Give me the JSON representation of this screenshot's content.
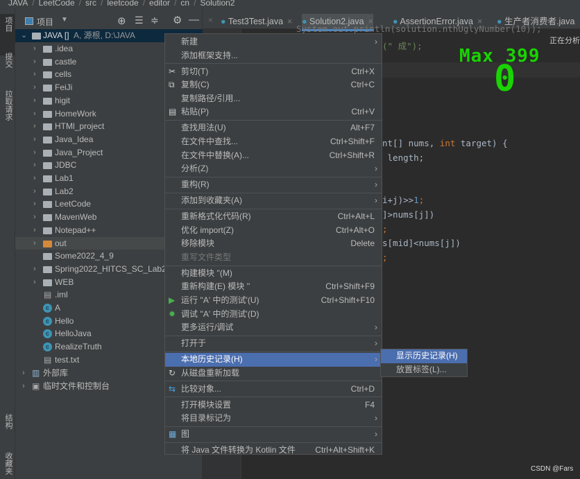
{
  "breadcrumb": [
    "JAVA",
    "LeetCode",
    "src",
    "leetcode",
    "editor",
    "cn",
    "Solution2"
  ],
  "left_strip": {
    "top": [
      "项目",
      "提交",
      "拉取请求"
    ],
    "bottom": [
      "结构",
      "收藏夹"
    ]
  },
  "project_panel": {
    "title": "项目",
    "root": {
      "name": "JAVA []",
      "detail": "A, 源根, D:\\JAVA"
    },
    "items": [
      {
        "name": ".idea",
        "type": "folder",
        "expandable": true
      },
      {
        "name": "castle",
        "type": "folder",
        "expandable": true
      },
      {
        "name": "cells",
        "type": "folder",
        "expandable": true
      },
      {
        "name": "FeiJi",
        "type": "folder",
        "expandable": true
      },
      {
        "name": "higit",
        "type": "folder",
        "expandable": true
      },
      {
        "name": "HomeWork",
        "type": "folder",
        "expandable": true
      },
      {
        "name": "HTMl_project",
        "type": "folder",
        "expandable": true
      },
      {
        "name": "Java_Idea",
        "type": "folder",
        "expandable": true
      },
      {
        "name": "Java_Project",
        "type": "folder",
        "expandable": true
      },
      {
        "name": "JDBC",
        "type": "folder",
        "expandable": true
      },
      {
        "name": "Lab1",
        "type": "folder",
        "expandable": true
      },
      {
        "name": "Lab2",
        "type": "folder",
        "expandable": true
      },
      {
        "name": "LeetCode",
        "type": "folder",
        "expandable": true
      },
      {
        "name": "MavenWeb",
        "type": "folder",
        "expandable": true
      },
      {
        "name": "Notepad++",
        "type": "folder",
        "expandable": true
      },
      {
        "name": "out",
        "type": "folder-orange",
        "expandable": true
      },
      {
        "name": "Some2022_4_9",
        "type": "folder",
        "expandable": false
      },
      {
        "name": "Spring2022_HITCS_SC_Lab2",
        "type": "folder",
        "expandable": true
      },
      {
        "name": "WEB",
        "type": "folder",
        "expandable": true
      },
      {
        "name": ".iml",
        "type": "iml",
        "expandable": false
      },
      {
        "name": "A",
        "type": "java-main",
        "expandable": false
      },
      {
        "name": "Hello",
        "type": "java-main",
        "expandable": false
      },
      {
        "name": "HelloJava",
        "type": "java-main",
        "expandable": false
      },
      {
        "name": "RealizeTruth",
        "type": "java",
        "expandable": false
      },
      {
        "name": "test.txt",
        "type": "text",
        "expandable": false
      }
    ],
    "external_libs": "外部库",
    "scratches": "临时文件和控制台"
  },
  "tabs": [
    {
      "label": "Test3Test.java"
    },
    {
      "label": "Solution2.java",
      "active": true
    },
    {
      "label": "AssertionError.java"
    },
    {
      "label": "生产者消费者.java"
    }
  ],
  "code": {
    "l1": "System.out.println(solution.nthUglyNumber(10));",
    "l2a": "(\"",
    "l2b": " 成\");",
    "l3a": "nt[] nums, ",
    "l3b": "int",
    " l3c": " target) {",
    "l4": " length;",
    "l5a": "i+j)>>",
    "l5b": "1",
    "l5c": ";",
    "l6": "]>nums[j])",
    "l7": ";",
    "l8": "s[mid]<nums[j])",
    "l9": ";"
  },
  "overlay": {
    "max_label": "Max 399",
    "counter": "0",
    "analyzing": "正在分析"
  },
  "context_menu": [
    {
      "label": "新建",
      "submenu": true
    },
    {
      "label": "添加框架支持..."
    },
    {
      "sep": true
    },
    {
      "label": "剪切(T)",
      "shortcut": "Ctrl+X",
      "icon": "scissors-icon"
    },
    {
      "label": "复制(C)",
      "shortcut": "Ctrl+C",
      "icon": "copy-icon"
    },
    {
      "label": "复制路径/引用..."
    },
    {
      "label": "粘贴(P)",
      "shortcut": "Ctrl+V",
      "icon": "paste-icon"
    },
    {
      "sep": true
    },
    {
      "label": "查找用法(U)",
      "shortcut": "Alt+F7"
    },
    {
      "label": "在文件中查找...",
      "shortcut": "Ctrl+Shift+F"
    },
    {
      "label": "在文件中替换(A)...",
      "shortcut": "Ctrl+Shift+R"
    },
    {
      "label": "分析(Z)",
      "submenu": true
    },
    {
      "sep": true
    },
    {
      "label": "重构(R)",
      "submenu": true
    },
    {
      "sep": true
    },
    {
      "label": "添加到收藏夹(A)",
      "submenu": true
    },
    {
      "sep": true
    },
    {
      "label": "重新格式化代码(R)",
      "shortcut": "Ctrl+Alt+L"
    },
    {
      "label": "优化 import(Z)",
      "shortcut": "Ctrl+Alt+O"
    },
    {
      "label": "移除模块",
      "shortcut": "Delete"
    },
    {
      "label": "重写文件类型",
      "disabled": true
    },
    {
      "sep": true
    },
    {
      "label": "构建模块 ''(M)"
    },
    {
      "label": "重新构建(E) 模块 ''",
      "shortcut": "Ctrl+Shift+F9"
    },
    {
      "label": "运行 ''A' 中的测试'(U)",
      "shortcut": "Ctrl+Shift+F10",
      "icon": "run-icon"
    },
    {
      "label": "调试 ''A' 中的测试'(D)",
      "icon": "debug-icon"
    },
    {
      "label": "更多运行/调试",
      "submenu": true
    },
    {
      "sep": true
    },
    {
      "label": "打开于",
      "submenu": true
    },
    {
      "sep": true
    },
    {
      "label": "本地历史记录(H)",
      "submenu": true,
      "selected": true
    },
    {
      "label": "从磁盘重新加载",
      "icon": "reload-icon"
    },
    {
      "sep": true
    },
    {
      "label": "比较对象...",
      "shortcut": "Ctrl+D",
      "icon": "compare-icon"
    },
    {
      "sep": true
    },
    {
      "label": "打开模块设置",
      "shortcut": "F4"
    },
    {
      "label": "将目录标记为",
      "submenu": true
    },
    {
      "sep": true
    },
    {
      "label": "图",
      "submenu": true,
      "icon": "diagram-icon"
    },
    {
      "sep": true
    },
    {
      "label": "将 Java 文件转换为 Kotlin 文件",
      "shortcut": "Ctrl+Alt+Shift+K"
    }
  ],
  "submenu": [
    {
      "label": "显示历史记录(H)",
      "selected": true
    },
    {
      "label": "放置标签(L)..."
    }
  ],
  "watermark": "CSDN @Fars",
  "colors": {
    "selection": "#4b6eaf",
    "overlay_green": "#19d400",
    "bg": "#2b2b2b",
    "panel": "#3c3f41"
  }
}
